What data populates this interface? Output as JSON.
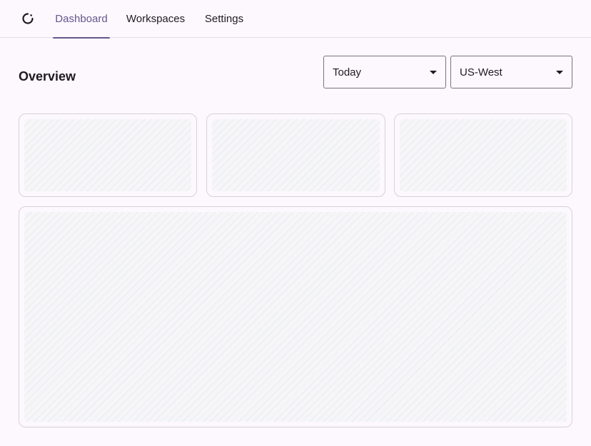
{
  "nav": {
    "logo_icon": "circle-loading-icon",
    "tabs": [
      {
        "label": "Dashboard",
        "active": true
      },
      {
        "label": "Workspaces",
        "active": false
      },
      {
        "label": "Settings",
        "active": false
      }
    ]
  },
  "overview": {
    "title": "Overview",
    "date_filter": {
      "selected": "Today"
    },
    "region_filter": {
      "selected": "US-West"
    }
  },
  "colors": {
    "accent": "#65558f",
    "background": "#fdf8fd",
    "card_border": "#d6d2da",
    "outline": "#79747e"
  }
}
